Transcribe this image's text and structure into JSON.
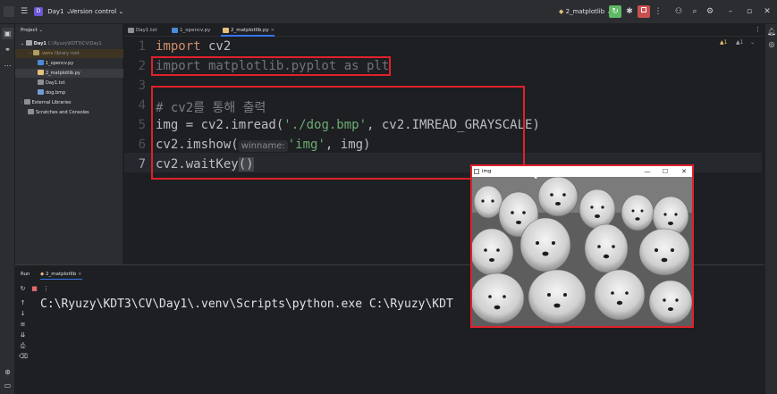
{
  "topbar": {
    "project_badge": "D",
    "project_name": "Day1",
    "vcs_label": "Version control",
    "run_config": "2_matplotlib"
  },
  "project_panel": {
    "title": "Project",
    "root_name": "Day1",
    "root_path": "C:\\Ryuzy\\KDT3\\CV\\Day1",
    "items": [
      {
        "name": ".venv",
        "note": "library root"
      },
      {
        "name": "1_opencv.py"
      },
      {
        "name": "2_matplotlib.py"
      },
      {
        "name": "Day1.txt"
      },
      {
        "name": "dog.bmp"
      }
    ],
    "external": "External Libraries",
    "scratches": "Scratches and Consoles"
  },
  "tabs": [
    {
      "label": "Day1.txt"
    },
    {
      "label": "1_opencv.py"
    },
    {
      "label": "2_matplotlib.py"
    }
  ],
  "editor": {
    "line_numbers": [
      "1",
      "2",
      "3",
      "4",
      "5",
      "6",
      "7"
    ],
    "line1": {
      "kw": "import",
      "rest": " cv2"
    },
    "line2": "import matplotlib.pyplot as plt",
    "line4": "# cv2를 통해 출력",
    "line5": {
      "pre": "img = cv2.imread(",
      "str": "'./dog.bmp'",
      "post": ", cv2.IMREAD_GRAYSCALE)"
    },
    "line6": {
      "pre": "cv2.imshow(",
      "hint": "winname:",
      "str": "'img'",
      "post": ", img)"
    },
    "line7": {
      "pre": "cv2.waitKey",
      "paren": "()"
    },
    "warnings": {
      "warn_count": "1",
      "weak_count": "1"
    }
  },
  "run_panel": {
    "title": "Run",
    "config": "2_matplotlib",
    "output": "C:\\Ryuzy\\KDT3\\CV\\Day1\\.venv\\Scripts\\python.exe C:\\Ryuzy\\KDT"
  },
  "image_window": {
    "title": "img",
    "min_icon": "minimize-icon",
    "max_icon": "maximize-icon",
    "close_icon": "close-icon"
  },
  "colors": {
    "highlight_box": "#e0212b",
    "accent": "#3574f0",
    "keyword": "#cf8e6d",
    "string": "#6aab73"
  }
}
